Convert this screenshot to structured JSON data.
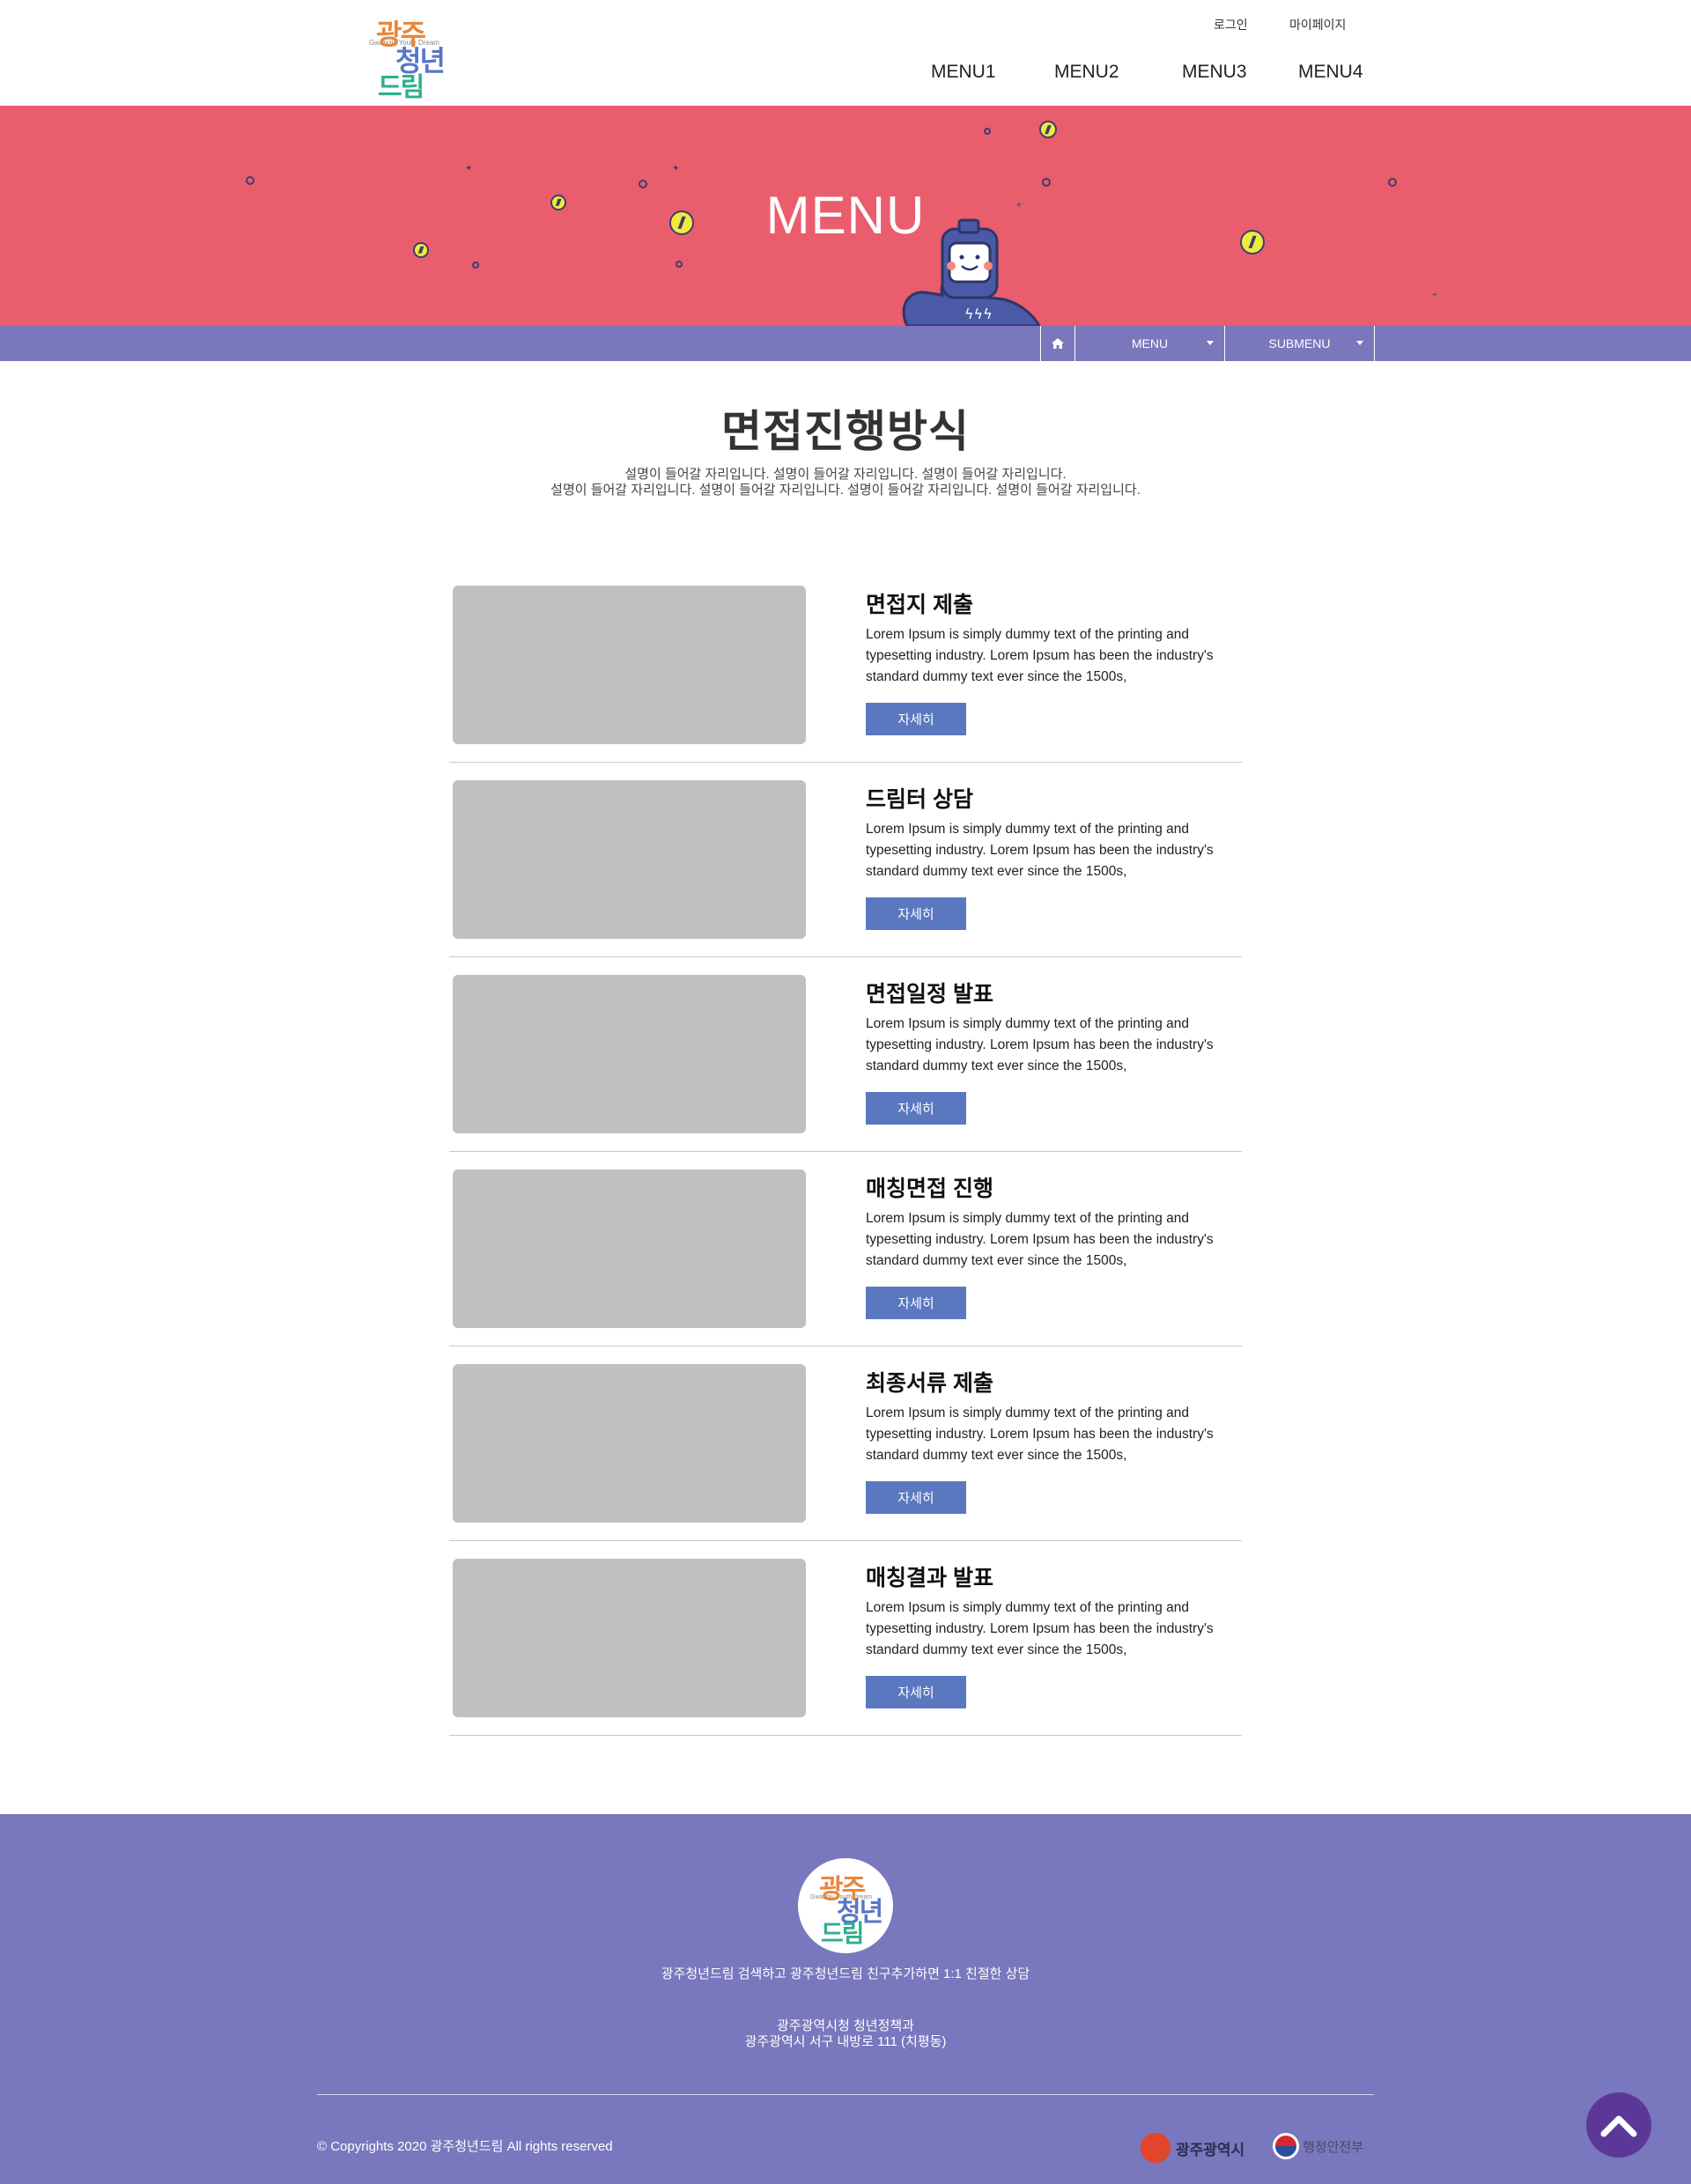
{
  "header": {
    "logo": {
      "line1": "광주",
      "line2": "청년",
      "line3": "드림",
      "sub": "Gwangju Youth Dream"
    },
    "util_links": {
      "login": "로그인",
      "mypage": "마이페이지"
    },
    "gnb": [
      "MENU1",
      "MENU2",
      "MENU3",
      "MENU4"
    ]
  },
  "hero": {
    "title": "MENU"
  },
  "location": {
    "menu": "MENU",
    "submenu": "SUBMENU"
  },
  "page": {
    "title": "면접진행방식",
    "desc_line1": "설명이 들어갈 자리입니다. 설명이 들어갈 자리입니다. 설명이 들어갈 자리입니다.",
    "desc_line2": "설명이 들어갈 자리입니다. 설명이 들어갈 자리입니다. 설명이 들어갈 자리입니다. 설명이 들어갈 자리입니다."
  },
  "steps": [
    {
      "title": "면접지 제출",
      "text": "Lorem Ipsum is simply dummy text of the printing and typesetting industry. Lorem Ipsum has been the industry's standard dummy text ever since the 1500s,",
      "button": "자세히"
    },
    {
      "title": "드림터 상담",
      "text": "Lorem Ipsum is simply dummy text of the printing and typesetting industry. Lorem Ipsum has been the industry's standard dummy text ever since the 1500s,",
      "button": "자세히"
    },
    {
      "title": "면접일정 발표",
      "text": "Lorem Ipsum is simply dummy text of the printing and typesetting industry. Lorem Ipsum has been the industry's standard dummy text ever since the 1500s,",
      "button": "자세히"
    },
    {
      "title": "매칭면접 진행",
      "text": "Lorem Ipsum is simply dummy text of the printing and typesetting industry. Lorem Ipsum has been the industry's standard dummy text ever since the 1500s,",
      "button": "자세히"
    },
    {
      "title": "최종서류 제출",
      "text": "Lorem Ipsum is simply dummy text of the printing and typesetting industry. Lorem Ipsum has been the industry's standard dummy text ever since the 1500s,",
      "button": "자세히"
    },
    {
      "title": "매칭결과 발표",
      "text": "Lorem Ipsum is simply dummy text of the printing and typesetting industry. Lorem Ipsum has been the industry's standard dummy text ever since the 1500s,",
      "button": "자세히"
    }
  ],
  "footer": {
    "logo": {
      "line1": "광주",
      "line2": "청년",
      "line3": "드림",
      "sub": "Gwangju Youth Dream"
    },
    "contact": "광주청년드림 검색하고 광주청년드림 친구추가하면 1:1 친절한 상담",
    "org": "광주광역시청 청년정책과",
    "address": "광주광역시 서구 내방로 111 (치평동)",
    "copyright": "© Copyrights 2020 광주청년드림 All rights reserved",
    "partners": {
      "gwangju": "광주광역시",
      "mois": "행정안전부"
    }
  },
  "colors": {
    "hero_bg": "#e95d6d",
    "location_bar": "#7a77bd",
    "button": "#5a78c0",
    "footer_bg": "#7977bd",
    "top_button": "#5b3898",
    "image_placeholder": "#c0c0c0"
  },
  "icons": {
    "home": "home-icon",
    "top": "chevron-up-icon",
    "caret": "caret-down-icon"
  }
}
